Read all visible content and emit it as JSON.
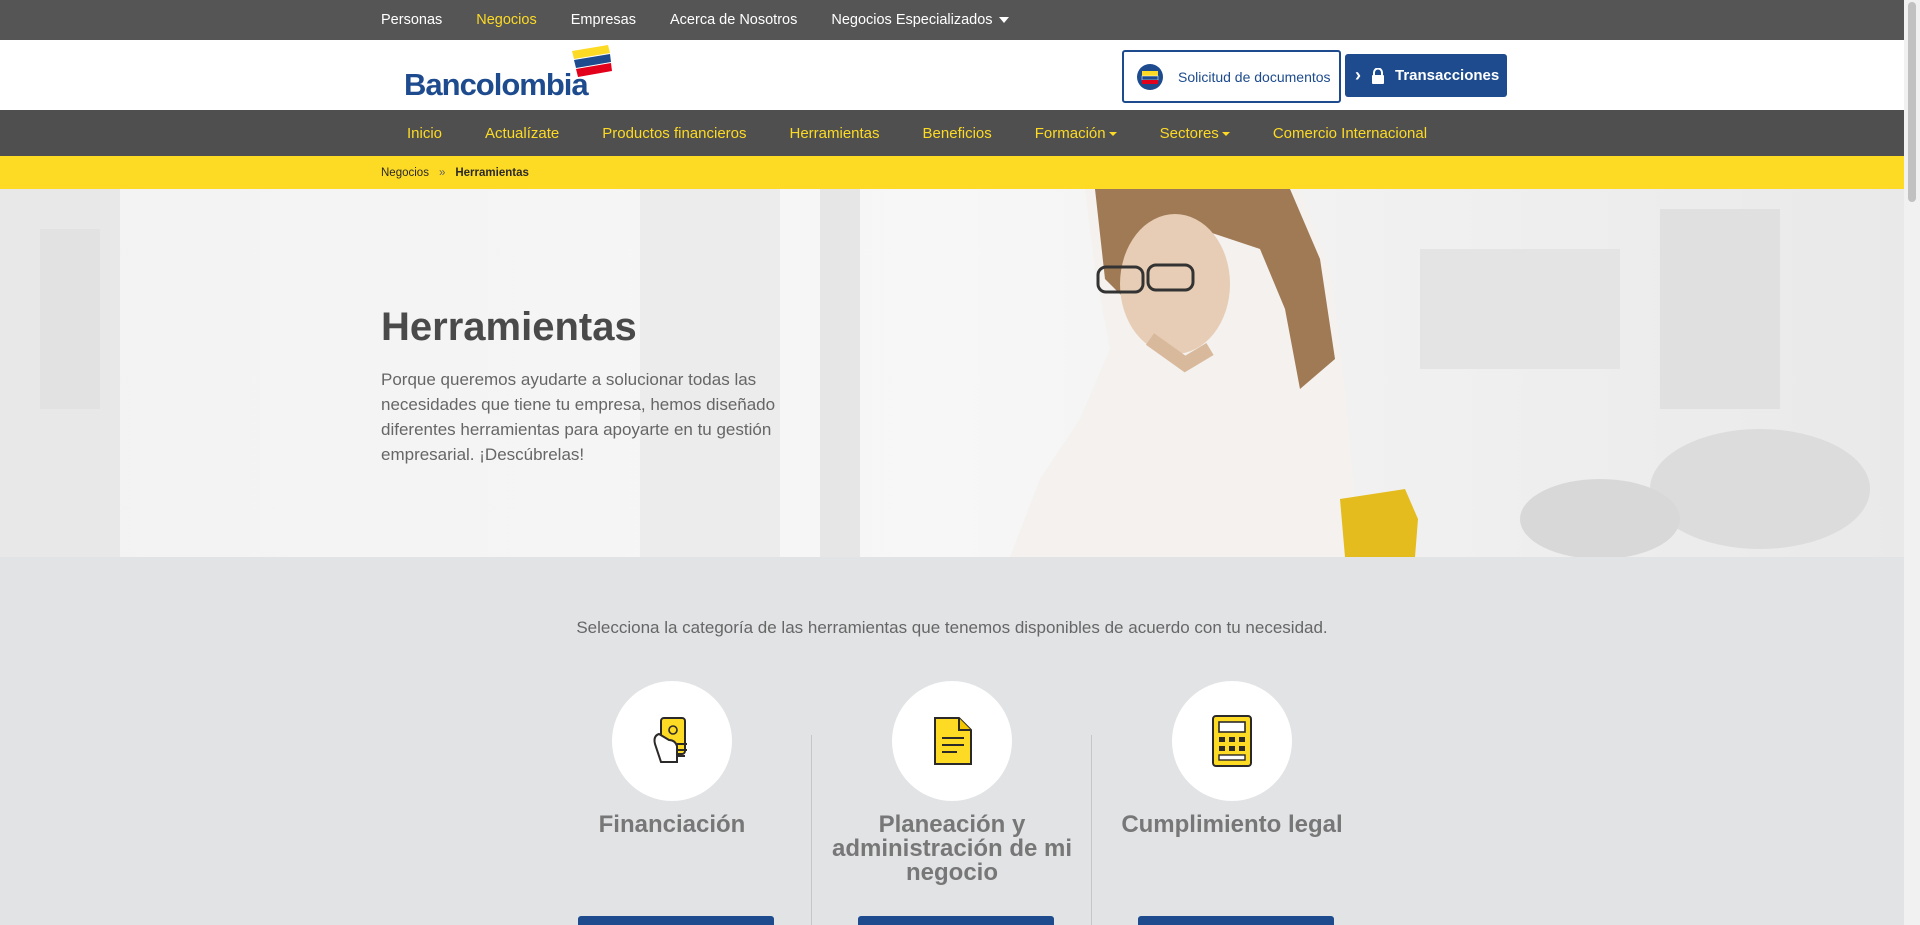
{
  "topbar": {
    "items": [
      {
        "label": "Personas",
        "active": false
      },
      {
        "label": "Negocios",
        "active": true
      },
      {
        "label": "Empresas",
        "active": false
      },
      {
        "label": "Acerca de Nosotros",
        "active": false
      },
      {
        "label": "Negocios Especializados",
        "active": false,
        "dropdown": true
      }
    ]
  },
  "header": {
    "logo_text": "Bancolombia",
    "docs_button_label": "Solicitud de documentos",
    "transactions_button_label": "Transacciones"
  },
  "mainnav": {
    "items": [
      {
        "label": "Inicio"
      },
      {
        "label": "Actualízate"
      },
      {
        "label": "Productos financieros"
      },
      {
        "label": "Herramientas"
      },
      {
        "label": "Beneficios"
      },
      {
        "label": "Formación",
        "dropdown": true
      },
      {
        "label": "Sectores",
        "dropdown": true
      },
      {
        "label": "Comercio Internacional"
      }
    ]
  },
  "breadcrumb": {
    "parent": "Negocios",
    "separator": "»",
    "current": "Herramientas"
  },
  "hero": {
    "title": "Herramientas",
    "description": "Porque queremos ayudarte a solucionar todas las necesidades que tiene tu empresa, hemos diseñado diferentes herramientas para apoyarte en tu gestión empresarial. ¡Descúbrelas!"
  },
  "categories": {
    "intro": "Selecciona la categoría de las herramientas que tenemos disponibles de acuerdo con tu necesidad.",
    "items": [
      {
        "title": "Financiación",
        "icon": "hand-money-icon"
      },
      {
        "title": "Planeación y administración de mi negocio",
        "icon": "document-icon"
      },
      {
        "title": "Cumplimiento legal",
        "icon": "calculator-icon"
      }
    ]
  },
  "colors": {
    "brand_blue": "#1d4b8e",
    "brand_yellow": "#fdda24",
    "topbar_gray": "#555555",
    "nav_gray": "#4f4f4f",
    "section_gray": "#e1e3e5"
  }
}
